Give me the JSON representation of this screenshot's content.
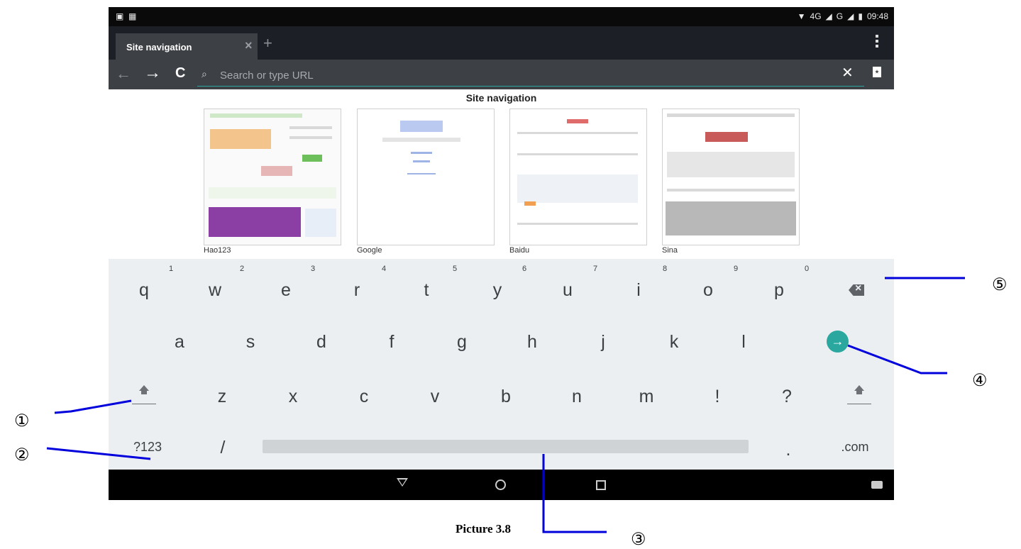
{
  "status_bar": {
    "network": "4G",
    "signal_label": "G",
    "time": "09:48"
  },
  "tab": {
    "title": "Site navigation",
    "close": "×",
    "new_tab": "+"
  },
  "url_bar": {
    "back": "←",
    "forward": "→",
    "reload": "C",
    "placeholder": "Search or type URL",
    "clear": "✕"
  },
  "page": {
    "heading": "Site navigation",
    "thumbnails": [
      {
        "label": "Hao123"
      },
      {
        "label": "Google"
      },
      {
        "label": "Baidu"
      },
      {
        "label": "Sina"
      }
    ]
  },
  "keyboard": {
    "row1": [
      "q",
      "w",
      "e",
      "r",
      "t",
      "y",
      "u",
      "i",
      "o",
      "p"
    ],
    "row1_hints": [
      "1",
      "2",
      "3",
      "4",
      "5",
      "6",
      "7",
      "8",
      "9",
      "0"
    ],
    "row2": [
      "a",
      "s",
      "d",
      "f",
      "g",
      "h",
      "j",
      "k",
      "l"
    ],
    "row3": [
      "z",
      "x",
      "c",
      "v",
      "b",
      "n",
      "m",
      "!",
      "?"
    ],
    "symbols": "?123",
    "slash": "/",
    "period": ".",
    "dotcom": ".com",
    "go": "→"
  },
  "annotations": {
    "c1": "①",
    "c2": "②",
    "c3": "③",
    "c4": "④",
    "c5": "⑤",
    "caption": "Picture 3.8"
  },
  "colors": {
    "accent": "#2aa79f",
    "keyboard_bg": "#eceff1",
    "toolbar": "#3d4045",
    "tabbar": "#1c1f26"
  },
  "icons": [
    "shift-icon",
    "delete-icon",
    "go-arrow-icon",
    "search-icon",
    "bookmark-icon",
    "menu-icon",
    "nav-back-icon",
    "nav-home-icon",
    "nav-recent-icon",
    "keyboard-icon"
  ]
}
